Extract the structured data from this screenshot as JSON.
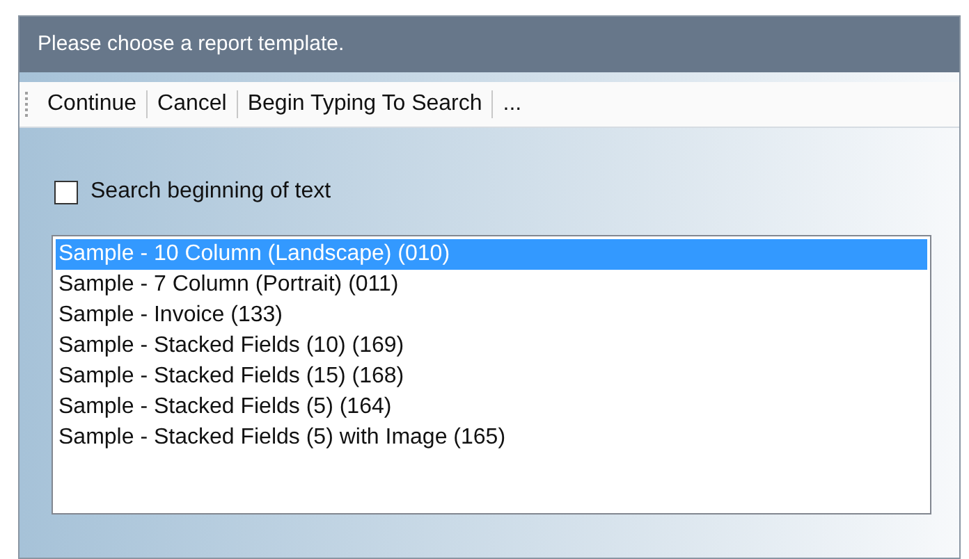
{
  "window": {
    "title": "Please choose a report template."
  },
  "toolbar": [
    {
      "label": "Continue"
    },
    {
      "label": "Cancel"
    },
    {
      "label": "Begin Typing To Search"
    },
    {
      "label": "..."
    }
  ],
  "search_option": {
    "label": "Search beginning of text",
    "checked": false
  },
  "templates": [
    {
      "label": "Sample - 10 Column (Landscape) (010)",
      "selected": true
    },
    {
      "label": "Sample - 7 Column (Portrait) (011)",
      "selected": false
    },
    {
      "label": "Sample - Invoice (133)",
      "selected": false
    },
    {
      "label": "Sample - Stacked Fields (10) (169)",
      "selected": false
    },
    {
      "label": "Sample - Stacked Fields (15) (168)",
      "selected": false
    },
    {
      "label": "Sample - Stacked Fields (5) (164)",
      "selected": false
    },
    {
      "label": "Sample - Stacked Fields (5) with Image (165)",
      "selected": false
    }
  ]
}
